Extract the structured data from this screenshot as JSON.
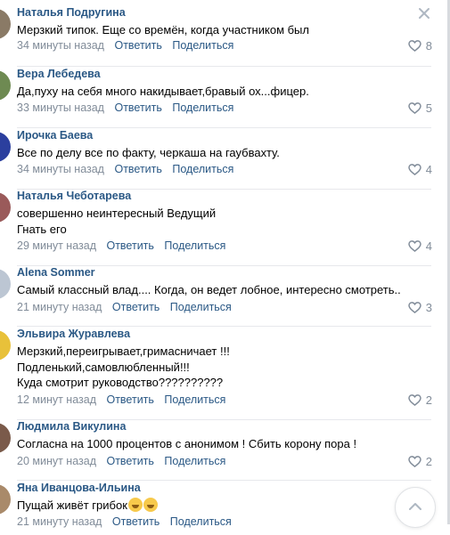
{
  "comments": [
    {
      "author": "Наталья Подругина",
      "text": "Мерзкий типок. Еще со времён, когда участником был",
      "time": "34 минуты назад",
      "reply": "Ответить",
      "share": "Поделиться",
      "likes": "8",
      "avatar_color": "#8a7a66"
    },
    {
      "author": "Вера Лебедева",
      "text": "Да,пуху на себя много накидывает,бравый ох...фицер.",
      "time": "33 минуты назад",
      "reply": "Ответить",
      "share": "Поделиться",
      "likes": "5",
      "avatar_color": "#6e8a52"
    },
    {
      "author": "Ирочка Баева",
      "text": "Все по делу все по факту, черкаша на гаубвахту.",
      "time": "34 минуты назад",
      "reply": "Ответить",
      "share": "Поделиться",
      "likes": "4",
      "avatar_color": "#2b3f9e"
    },
    {
      "author": "Наталья Чеботарева",
      "text": "совершенно неинтересный Ведущий\nГнать его",
      "time": "29 минут назад",
      "reply": "Ответить",
      "share": "Поделиться",
      "likes": "4",
      "avatar_color": "#9a5a5a"
    },
    {
      "author": "Alena Sommer",
      "text": "Самый классный влад.... Когда, он ведет лобное, интересно смотреть..",
      "time": "21 минуту назад",
      "reply": "Ответить",
      "share": "Поделиться",
      "likes": "3",
      "avatar_color": "#bcc6d3"
    },
    {
      "author": "Эльвира Журавлева",
      "text": "Мерзкий,переигрывает,гримасничает !!!\nПодленький,самовлюбленный!!!\nКуда смотрит руководство??????????",
      "time": "12 минут назад",
      "reply": "Ответить",
      "share": "Поделиться",
      "likes": "2",
      "avatar_color": "#e8c13a"
    },
    {
      "author": "Людмила Викулина",
      "text": "Согласна на 1000 процентов с анонимом ! Сбить корону пора !",
      "time": "20 минут назад",
      "reply": "Ответить",
      "share": "Поделиться",
      "likes": "2",
      "avatar_color": "#7a5a4a"
    },
    {
      "author": "Яна Иванцова-Ильина",
      "text": "Пущай живёт грибок",
      "time": "21 минуту назад",
      "reply": "Ответить",
      "share": "Поделиться",
      "likes": "",
      "avatar_color": "#a98a6a"
    }
  ],
  "icons": {
    "close": "close-icon",
    "like": "heart-icon",
    "scroll_up": "chevron-up-icon"
  },
  "colors": {
    "link": "#2a5885",
    "meta": "#818c99",
    "divider": "#e7e8ec"
  }
}
